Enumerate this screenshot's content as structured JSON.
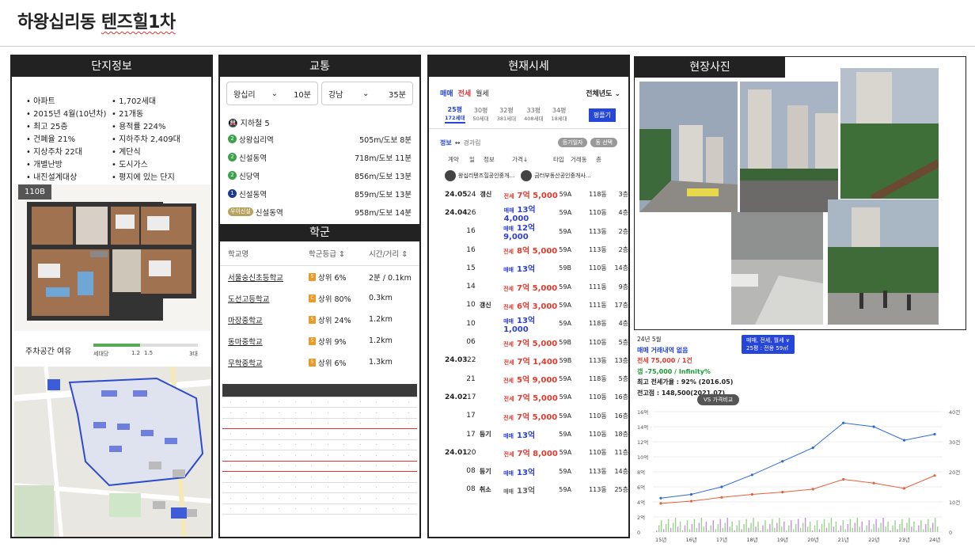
{
  "page_title_plain": "하왕십리동 ",
  "page_title_ul": "텐즈힐1차",
  "panel1": {
    "title": "단지정보",
    "info": [
      "아파트",
      "1,702세대",
      "2015년 4월(10년차)",
      "21개동",
      "최고 25층",
      "용적률 224%",
      "건폐율 21%",
      "지하주차 2,409대",
      "지상주차 22대",
      "계단식",
      "개별난방",
      "도시가스",
      "내진설계대상",
      "평지에 있는 단지"
    ],
    "floorplan_label": "110B",
    "parking_label": "주차공간 여유",
    "parking_ticks": [
      "세대당",
      "1.2",
      "1.5",
      "3대"
    ],
    "parking_ratio": 0.45
  },
  "panel2": {
    "title": "교통",
    "routes": [
      {
        "name": "왕십리",
        "time": "10분"
      },
      {
        "name": "강남",
        "time": "35분"
      }
    ],
    "subway_title": "지하철 5",
    "stations": [
      {
        "badge": "2",
        "color": "#3aa34a",
        "name": "상왕십리역",
        "dist": "505m/도보 8분"
      },
      {
        "badge": "2",
        "color": "#3aa34a",
        "name": "신설동역",
        "dist": "718m/도보 11분"
      },
      {
        "badge": "2",
        "color": "#3aa34a",
        "name": "신당역",
        "dist": "856m/도보 13분"
      },
      {
        "badge": "1",
        "color": "#1f3c8c",
        "name": "신설동역",
        "dist": "859m/도보 13분"
      },
      {
        "badge": "우이신설",
        "color": "#b8a25e",
        "name": "신설동역",
        "dist": "958m/도보 14분"
      }
    ],
    "school_title": "학군",
    "school_cols": [
      "학교명",
      "학군등급",
      "시간/거리"
    ],
    "schools": [
      {
        "name": "서울숭신초등학교",
        "badge": "5",
        "grade": "상위 6%",
        "dist": "2분 / 0.1km"
      },
      {
        "name": "도선고등학교",
        "badge": "C",
        "grade": "상위 80%",
        "dist": "0.3km"
      },
      {
        "name": "마장중학교",
        "badge": "5",
        "grade": "상위 24%",
        "dist": "1.2km"
      },
      {
        "name": "동마중학교",
        "badge": "5",
        "grade": "상위 9%",
        "dist": "1.2km"
      },
      {
        "name": "무학중학교",
        "badge": "5",
        "grade": "상위 6%",
        "dist": "1.3km"
      }
    ]
  },
  "panel3": {
    "title": "현재시세",
    "tabs": [
      "매매",
      "전세",
      "월세"
    ],
    "period": "전체년도",
    "sizes": [
      {
        "name": "25평",
        "sub": "172세대"
      },
      {
        "name": "30평",
        "sub": "50세대"
      },
      {
        "name": "32평",
        "sub": "381세대"
      },
      {
        "name": "33평",
        "sub": "408세대"
      },
      {
        "name": "34평",
        "sub": "18세대"
      }
    ],
    "size_btn": "평플기",
    "filter_left": "정보",
    "filter_mid": "경과림",
    "chips": [
      "등기일자",
      "동 선택"
    ],
    "tx_cols": [
      "계약",
      "일",
      "정보",
      "가격",
      "타입",
      "거래동",
      "층"
    ],
    "agents": [
      "왕십리텐즈힐공인중개…",
      "금터부동산공인중개사…"
    ],
    "rows": [
      {
        "ym": "24.05",
        "d": "24",
        "info": "갱신",
        "kind": "전세",
        "price": "7억 5,000",
        "type": "59A",
        "dong": "118동",
        "fl": "3층",
        "c": "red"
      },
      {
        "ym": "24.04",
        "d": "26",
        "info": "",
        "kind": "매매",
        "price": "13억 4,000",
        "type": "59A",
        "dong": "110동",
        "fl": "4층",
        "c": "blue"
      },
      {
        "ym": "",
        "d": "16",
        "info": "",
        "kind": "매매",
        "price": "12억 9,000",
        "type": "59A",
        "dong": "113동",
        "fl": "2층",
        "c": "blue"
      },
      {
        "ym": "",
        "d": "16",
        "info": "",
        "kind": "전세",
        "price": "8억 5,000",
        "type": "59A",
        "dong": "113동",
        "fl": "2층",
        "c": "red"
      },
      {
        "ym": "",
        "d": "15",
        "info": "",
        "kind": "매매",
        "price": "13억",
        "type": "59B",
        "dong": "110동",
        "fl": "14층",
        "c": "blue"
      },
      {
        "ym": "",
        "d": "14",
        "info": "",
        "kind": "전세",
        "price": "7억 5,000",
        "type": "59A",
        "dong": "111동",
        "fl": "9층",
        "c": "red"
      },
      {
        "ym": "",
        "d": "10",
        "info": "갱신",
        "kind": "전세",
        "price": "6억 3,000",
        "type": "59A",
        "dong": "111동",
        "fl": "17층",
        "c": "red"
      },
      {
        "ym": "",
        "d": "10",
        "info": "",
        "kind": "매매",
        "price": "13억 1,000",
        "type": "59A",
        "dong": "118동",
        "fl": "4층",
        "c": "blue"
      },
      {
        "ym": "",
        "d": "06",
        "info": "",
        "kind": "전세",
        "price": "7억 5,000",
        "type": "59B",
        "dong": "110동",
        "fl": "5층",
        "c": "red"
      },
      {
        "ym": "24.03",
        "d": "22",
        "info": "",
        "kind": "전세",
        "price": "7억 1,400",
        "type": "59B",
        "dong": "113동",
        "fl": "13층",
        "c": "red"
      },
      {
        "ym": "",
        "d": "21",
        "info": "",
        "kind": "전세",
        "price": "5억 9,000",
        "type": "59A",
        "dong": "118동",
        "fl": "5층",
        "c": "red"
      },
      {
        "ym": "24.02",
        "d": "17",
        "info": "",
        "kind": "전세",
        "price": "7억 5,000",
        "type": "59A",
        "dong": "110동",
        "fl": "16층",
        "c": "red"
      },
      {
        "ym": "",
        "d": "17",
        "info": "",
        "kind": "전세",
        "price": "7억 5,000",
        "type": "59A",
        "dong": "110동",
        "fl": "16층",
        "c": "red"
      },
      {
        "ym": "",
        "d": "17",
        "info": "등기",
        "kind": "매매",
        "price": "13억",
        "type": "59A",
        "dong": "110동",
        "fl": "18층",
        "c": "blue"
      },
      {
        "ym": "24.01",
        "d": "20",
        "info": "",
        "kind": "전세",
        "price": "7억 8,000",
        "type": "59A",
        "dong": "110동",
        "fl": "11층",
        "c": "red"
      },
      {
        "ym": "",
        "d": "08",
        "info": "등기",
        "kind": "매매",
        "price": "13억",
        "type": "59A",
        "dong": "113동",
        "fl": "14층",
        "c": "blue"
      },
      {
        "ym": "",
        "d": "08",
        "info": "취소",
        "kind": "매매",
        "price": "13억",
        "type": "59A",
        "dong": "113동",
        "fl": "25층",
        "c": "gray"
      }
    ]
  },
  "panel4": {
    "title": "현장사진"
  },
  "chart_panel": {
    "month": "24년 5월",
    "line1": "매매 거래내역 없음",
    "line2": "전세 75,000 / 1건",
    "line3": "갭   -75,000 / Infinity%",
    "line4": "최고 전세가율 : 92% (2016.05)",
    "line5": "전고점 : 148,500(2021.07)",
    "selector": "매매, 전세, 월세 ∨",
    "selector2": "25평 : 전용 59㎡",
    "vs_button": "VS 가격비교"
  },
  "chart_data": {
    "type": "line",
    "x": [
      "15년",
      "16년",
      "17년",
      "18년",
      "19년",
      "20년",
      "21년",
      "22년",
      "23년",
      "24년"
    ],
    "y_left_ticks": [
      "16억",
      "14억",
      "12억",
      "10억",
      "8억",
      "6억",
      "4억",
      "2억",
      "0"
    ],
    "y_right_ticks": [
      "40건",
      "30건",
      "20건",
      "10건",
      "0"
    ],
    "ylim": [
      0,
      16
    ],
    "series": [
      {
        "name": "매매",
        "color": "#2c6ad8",
        "values": [
          4.5,
          5.0,
          6.0,
          7.6,
          9.4,
          11.2,
          14.5,
          14.0,
          12.2,
          13.0
        ]
      },
      {
        "name": "전세",
        "color": "#e8603c",
        "values": [
          3.8,
          4.1,
          4.6,
          5.0,
          5.3,
          5.7,
          7.0,
          6.5,
          5.8,
          7.5
        ]
      }
    ],
    "colors": {
      "buy": "#2c6ad8",
      "rent": "#e8603c"
    }
  }
}
